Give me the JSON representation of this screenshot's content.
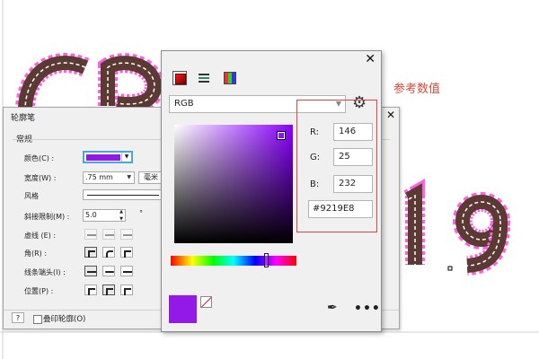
{
  "annotation": {
    "label": "参考数值",
    "color": "#d84a3c"
  },
  "outline_pen": {
    "title": "轮廓笔",
    "group_label": "常规",
    "rows": {
      "color": "颜色(C) :",
      "width": "宽度(W) :",
      "style": "风格",
      "miter": "斜接限制(M) :",
      "dash": "虚线 (E) :",
      "corner": "角(R) :",
      "line_caps": "线条端头(I) :",
      "position": "位置(P) :"
    },
    "width_value": ".75 mm",
    "width_unit": "毫米",
    "miter_value": "5.0",
    "miter_unit": "°",
    "help_label": "?",
    "overprint_label": "叠印轮廓(O)",
    "selected_color": "#9219E8"
  },
  "color_picker": {
    "model": "RGB",
    "components": [
      {
        "label": "R:",
        "value": "146"
      },
      {
        "label": "G:",
        "value": "25"
      },
      {
        "label": "B:",
        "value": "232"
      }
    ],
    "hex": "#9219E8",
    "current_color": "#9219E8",
    "close_glyph": "✕",
    "gear_glyph": "⚙",
    "more_glyph": "•••",
    "icons": [
      "color-eyedropper-icon",
      "more-options-icon",
      "gear-icon",
      "color-viewer-icon",
      "color-sliders-icon",
      "color-palette-icon"
    ]
  },
  "colors": {
    "artwork_fill": "#5a3a33",
    "artwork_stroke": "#ff3fd6",
    "accent": "#4aa8d8"
  }
}
